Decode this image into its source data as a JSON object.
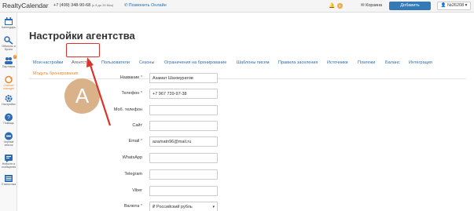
{
  "topbar": {
    "logo": "RealtyCalendar",
    "phone": "+7 (499) 348-90-68",
    "phone_hours": "(с 8 до 20 Мск)",
    "call_link": "Позвонить Онлайн",
    "bell_count": "4",
    "cart_label": "Корзина",
    "add_label": "Добавить",
    "user_label": "№26208"
  },
  "sidebar": {
    "items": [
      {
        "label": "Календарь",
        "icon": "calendar-icon"
      },
      {
        "label": "Объекты и Брони",
        "icon": "key-icon"
      },
      {
        "label": "Партнеры",
        "icon": "partners-icon",
        "badge": "2"
      },
      {
        "label": "Channel manager",
        "icon": "sync-icon"
      },
      {
        "label": "Настройки",
        "icon": "gear-icon"
      },
      {
        "label": "Помощь",
        "icon": "help-icon"
      },
      {
        "label": "Черный список",
        "icon": "blacklist-icon"
      },
      {
        "label": "Новости и сообщения",
        "icon": "news-icon"
      },
      {
        "label": "Статистика",
        "icon": "stats-icon"
      }
    ]
  },
  "page": {
    "title": "Настройки агентства"
  },
  "tabs": [
    "Мои настройки",
    "Агентство",
    "Пользователи",
    "Сезоны",
    "Ограничения на бронирование",
    "Шаблоны писем",
    "Правила заселения",
    "Источники",
    "Платежи",
    "Баланс",
    "Интеграция",
    "Модуль бронирования"
  ],
  "avatar_letter": "A",
  "form": {
    "fields": [
      {
        "label": "Название",
        "required": "*",
        "value": "Азамат Шахмуратов"
      },
      {
        "label": "Телефон",
        "required": "*",
        "value": "+7 967 739-97-38"
      },
      {
        "label": "Моб. телефон",
        "required": "",
        "value": ""
      },
      {
        "label": "Сайт",
        "required": "",
        "value": ""
      },
      {
        "label": "Email",
        "required": "*",
        "value": "azamatn96@mail.ru"
      },
      {
        "label": "WhatsApp",
        "required": "",
        "value": ""
      },
      {
        "label": "Telegram",
        "required": "",
        "value": ""
      },
      {
        "label": "Viber",
        "required": "",
        "value": ""
      }
    ],
    "currency": {
      "label": "Валюта",
      "required": "*",
      "value": "₽ Российский рубль"
    }
  },
  "colors": {
    "link": "#2a6bb3",
    "accent_orange": "#e8892d",
    "primary_button": "#337ab7",
    "highlight_red": "#d9342b",
    "avatar": "#d9b28a"
  }
}
